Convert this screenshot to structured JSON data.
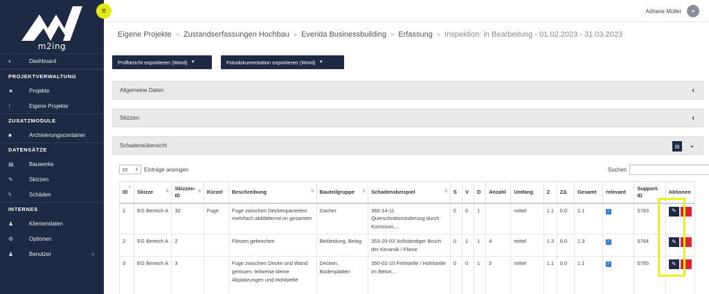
{
  "app": {
    "logo_text": "m2ing"
  },
  "user": {
    "name": "Adriane Müller"
  },
  "sidebar": {
    "dashboard": "Dashboard",
    "sections": {
      "projekte": "PROJEKTVERWALTUNG",
      "zusatz": "ZUSATZMODULE",
      "daten": "DATENSÄTZE",
      "internes": "INTERNES"
    },
    "items": {
      "projekte": "Projekte",
      "eigene_projekte": "Eigene Projekte",
      "archiv": "Archivierungscontainer",
      "bauwerke": "Bauwerke",
      "skizzen": "Skizzen",
      "schaeden": "Schäden",
      "klientendaten": "Klientendaten",
      "optionen": "Optionen",
      "benutzer": "Benutzer"
    }
  },
  "breadcrumb": {
    "b1": "Eigene Projekte",
    "b2": "Zustandserfassungen Hochbau",
    "b3": "Everida Businessbuilding",
    "b4": "Erfassung",
    "b5": "Inspektion: in Bearbeitung - 01.02.2023 - 31.03.2023"
  },
  "buttons": {
    "export_word": "Prüfbericht exportieren (Word)",
    "export_photo": "Fotodokumentation exportieren (Word)"
  },
  "panels": {
    "allgemein": "Allgemeine Daten",
    "skizzen": "Skizzen",
    "schaden": "Schadensübersicht"
  },
  "table_controls": {
    "length_value": "10",
    "length_label": "Einträge anzeigen",
    "search_label": "Suchen",
    "search_value": ""
  },
  "table": {
    "headers": {
      "id": "ID",
      "skizze": "Skizze",
      "skizzen_id": "Skizzen-ID",
      "kuerzel": "Kürzel",
      "beschreibung": "Beschreibung",
      "bauteilgruppe": "Bauteilgruppe",
      "schadensbeispiel": "Schadensbeispiel",
      "s": "S",
      "v": "V",
      "d": "D",
      "anzahl": "Anzahl",
      "umfang": "Umfang",
      "z": "Z",
      "zd": "ZΔ",
      "gesamt": "Gesamt",
      "relevant": "relevant",
      "support_id": "Support-ID",
      "aktionen": "Aktionen"
    },
    "rows": [
      {
        "id": "1",
        "skizze": "EG Bereich A",
        "skizzen_id": "32",
        "kuerzel": "Fuge",
        "beschreibung": "Fuge zwischen Deckenpaneelen mehrfach abblätternd im gesamten",
        "bauteilgruppe": "Dächer",
        "schadensbeispiel": "360-14-11 Querschnittsminderung durch Korrosion,...",
        "s": "0",
        "v": "0",
        "d": "1",
        "anzahl": "",
        "umfang": "mittel",
        "z": "1.1",
        "zd": "0.0",
        "gesamt": "1.1",
        "relevant": true,
        "support_id": "5783"
      },
      {
        "id": "2",
        "skizze": "EG Bereich A",
        "skizzen_id": "2",
        "kuerzel": "",
        "beschreibung": "Fliesen gebrochen",
        "bauteilgruppe": "Bekleidung, Belag",
        "schadensbeispiel": "353-20-03 Vollständiger Bruch der Keramik / Fliese",
        "s": "0",
        "v": "1",
        "d": "1",
        "anzahl": "4",
        "umfang": "mittel",
        "z": "1.3",
        "zd": "0.0",
        "gesamt": "1.3",
        "relevant": true,
        "support_id": "5784"
      },
      {
        "id": "3",
        "skizze": "EG Bereich A",
        "skizzen_id": "3",
        "kuerzel": "",
        "beschreibung": "Fuge zwischen Decke und Wand gerissen, teilweise kleine Abplatzungen und Hohlstelle",
        "bauteilgruppe": "Decken, Bodenplatten",
        "schadensbeispiel": "350-02-10 Fehlstelle / Hohlstelle im Beton...",
        "s": "0",
        "v": "0",
        "d": "1",
        "anzahl": "2",
        "umfang": "mittel",
        "z": "1.1",
        "zd": "0.0",
        "gesamt": "1.1",
        "relevant": true,
        "support_id": "5785"
      }
    ]
  },
  "colors": {
    "sidebar": "#1e2a44",
    "accent_yellow": "#e3ea13",
    "delete_red": "#e0242d",
    "checkbox_blue": "#2f7de1"
  },
  "icons": {
    "menu": "hamburger-icon",
    "dashboard": "dashboard-icon",
    "projekte": "star-icon",
    "eigene_projekte": "branch-icon",
    "archiv": "container-icon",
    "bauwerke": "building-icon",
    "skizzen": "edit-icon",
    "schaeden": "bolt-icon",
    "klientendaten": "person-icon",
    "optionen": "gears-icon",
    "benutzer": "user-icon",
    "pdf": "pdf-icon",
    "edit": "pencil-icon",
    "delete": "trash-icon"
  }
}
